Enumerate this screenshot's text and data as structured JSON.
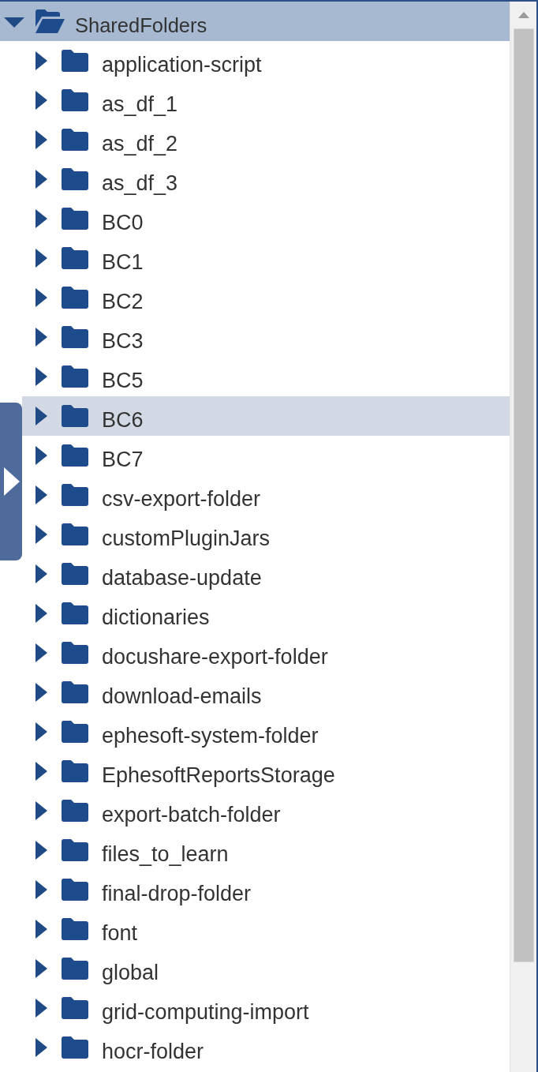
{
  "tree": {
    "label": "SharedFolders",
    "expanded": true,
    "selected": true,
    "hovered": false,
    "children": [
      {
        "label": "application-script",
        "expanded": false,
        "selected": false,
        "hovered": false
      },
      {
        "label": "as_df_1",
        "expanded": false,
        "selected": false,
        "hovered": false
      },
      {
        "label": "as_df_2",
        "expanded": false,
        "selected": false,
        "hovered": false
      },
      {
        "label": "as_df_3",
        "expanded": false,
        "selected": false,
        "hovered": false
      },
      {
        "label": "BC0",
        "expanded": false,
        "selected": false,
        "hovered": false
      },
      {
        "label": "BC1",
        "expanded": false,
        "selected": false,
        "hovered": false
      },
      {
        "label": "BC2",
        "expanded": false,
        "selected": false,
        "hovered": false
      },
      {
        "label": "BC3",
        "expanded": false,
        "selected": false,
        "hovered": false
      },
      {
        "label": "BC5",
        "expanded": false,
        "selected": false,
        "hovered": false
      },
      {
        "label": "BC6",
        "expanded": false,
        "selected": false,
        "hovered": true
      },
      {
        "label": "BC7",
        "expanded": false,
        "selected": false,
        "hovered": false
      },
      {
        "label": "csv-export-folder",
        "expanded": false,
        "selected": false,
        "hovered": false
      },
      {
        "label": "customPluginJars",
        "expanded": false,
        "selected": false,
        "hovered": false
      },
      {
        "label": "database-update",
        "expanded": false,
        "selected": false,
        "hovered": false
      },
      {
        "label": "dictionaries",
        "expanded": false,
        "selected": false,
        "hovered": false
      },
      {
        "label": "docushare-export-folder",
        "expanded": false,
        "selected": false,
        "hovered": false
      },
      {
        "label": "download-emails",
        "expanded": false,
        "selected": false,
        "hovered": false
      },
      {
        "label": "ephesoft-system-folder",
        "expanded": false,
        "selected": false,
        "hovered": false
      },
      {
        "label": "EphesoftReportsStorage",
        "expanded": false,
        "selected": false,
        "hovered": false
      },
      {
        "label": "export-batch-folder",
        "expanded": false,
        "selected": false,
        "hovered": false
      },
      {
        "label": "files_to_learn",
        "expanded": false,
        "selected": false,
        "hovered": false
      },
      {
        "label": "final-drop-folder",
        "expanded": false,
        "selected": false,
        "hovered": false
      },
      {
        "label": "font",
        "expanded": false,
        "selected": false,
        "hovered": false
      },
      {
        "label": "global",
        "expanded": false,
        "selected": false,
        "hovered": false
      },
      {
        "label": "grid-computing-import",
        "expanded": false,
        "selected": false,
        "hovered": false
      },
      {
        "label": "hocr-folder",
        "expanded": false,
        "selected": false,
        "hovered": false
      }
    ]
  }
}
